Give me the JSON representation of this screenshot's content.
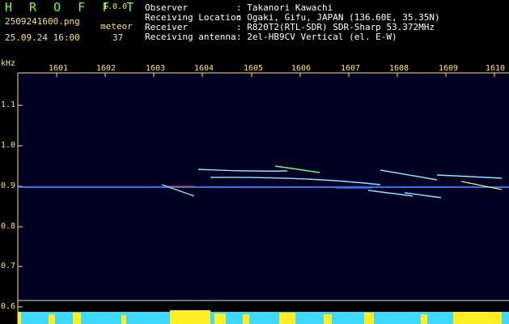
{
  "header": {
    "app_name": "H R O F F T",
    "version": "1.0.0",
    "filename": "2509241600.png",
    "datetime": "25.09.24 16:00",
    "meteor_label": "meteor",
    "meteor_count": "37",
    "info": [
      {
        "key": "Observer",
        "value": ": Takanori Kawachi"
      },
      {
        "key": "Receiving Location",
        "value": ": Ogaki, Gifu, JAPAN (136.60E, 35.35N)"
      },
      {
        "key": "Receiver",
        "value": ": R820T2(RTL-SDR) SDR-Sharp 53.372MHz"
      },
      {
        "key": "Receiving antenna",
        "value": ": 2el-HB9CV Vertical (el. E-W)"
      }
    ]
  },
  "spectrogram": {
    "y_unit": "kHz",
    "y_ticks": [
      "1.1",
      "1.0",
      "0.9",
      "0.8",
      "0.7",
      "0.6"
    ],
    "x_ticks": [
      "1601",
      "1602",
      "1603",
      "1604",
      "1605",
      "1606",
      "1607",
      "1608",
      "1609",
      "1610"
    ],
    "colors": {
      "background": "#000022",
      "carrier": "#2f6bff",
      "trace": "#8de5ff",
      "bar": "#3fd8ff",
      "bar_peak": "#ffee22"
    }
  }
}
